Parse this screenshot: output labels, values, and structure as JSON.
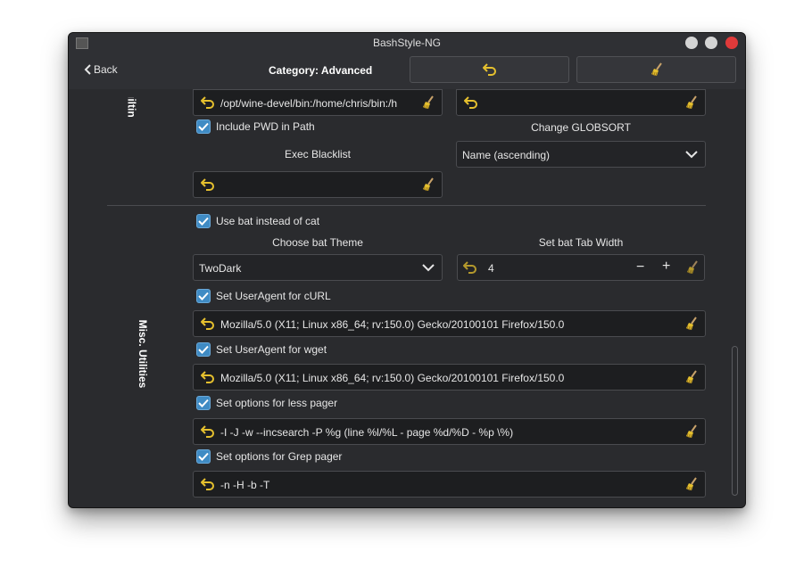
{
  "window": {
    "title": "BashStyle-NG"
  },
  "header": {
    "back_label": "Back",
    "category_title": "Category: Advanced"
  },
  "sections": {
    "builtin_label": "Builtin",
    "misc_label": "Misc. Utilities"
  },
  "builtin": {
    "path_value": "/opt/wine-devel/bin:/home/chris/bin:/h",
    "cdpath_value": "",
    "include_pwd_label": "Include PWD in Path",
    "include_pwd_checked": true,
    "globsort_label": "Change GLOBSORT",
    "globsort_value": "Name (ascending)",
    "exec_blacklist_label": "Exec Blacklist",
    "exec_blacklist_value": ""
  },
  "misc": {
    "use_bat_label": "Use bat instead of cat",
    "use_bat_checked": true,
    "bat_theme_label": "Choose bat Theme",
    "bat_theme_value": "TwoDark",
    "bat_tab_label": "Set bat Tab Width",
    "bat_tab_value": "4",
    "minus": "−",
    "plus": "+",
    "curl_ua_label": "Set UserAgent for cURL",
    "curl_ua_value": "Mozilla/5.0 (X11; Linux x86_64; rv:150.0) Gecko/20100101 Firefox/150.0",
    "wget_ua_label": "Set UserAgent for wget",
    "wget_ua_value": "Mozilla/5.0 (X11; Linux x86_64; rv:150.0) Gecko/20100101 Firefox/150.0",
    "less_label": "Set options for less pager",
    "less_value": "-I -J -w --incsearch -P %g (line %l/%L - page %d/%D - %p \\%)",
    "grep_label": "Set options for Grep pager",
    "grep_value": "-n -H -b -T"
  },
  "colors": {
    "accent": "#3f8bc4",
    "icon_yellow": "#e5c02e",
    "close_red": "#e03a3a"
  },
  "icons": {
    "undo": "undo-icon",
    "clear": "broom-icon",
    "back": "chevron-left-icon",
    "dropdown": "chevron-down-icon"
  }
}
